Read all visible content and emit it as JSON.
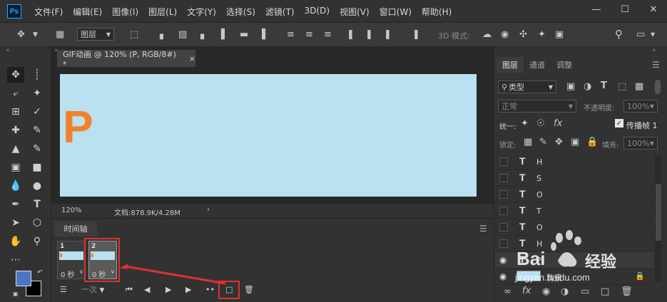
{
  "app": {
    "logo_text": "Ps"
  },
  "menu": [
    "文件(F)",
    "编辑(E)",
    "图像(I)",
    "图层(L)",
    "文字(Y)",
    "选择(S)",
    "滤镜(T)",
    "3D(D)",
    "视图(V)",
    "窗口(W)",
    "帮助(H)"
  ],
  "options": {
    "auto_select_value": "图层",
    "mode3d_label": "3D 模式:"
  },
  "document": {
    "tab_title": "GIF动画 @ 120% (P, RGB/8#) *",
    "canvas_text": "P",
    "zoom": "120%",
    "doc_info": "文档:878.9K/4.28M",
    "canvas_color": "#b9e1f0",
    "letter_color": "#f2812e"
  },
  "timeline": {
    "tab_label": "时间轴",
    "loop_option": "一次",
    "frames": [
      {
        "number": "1",
        "delay": "0 秒"
      },
      {
        "number": "2",
        "delay": "0 秒"
      }
    ],
    "highlight_color": "#e0312f"
  },
  "colors": {
    "foreground": "#4a75c1",
    "background": "#000000"
  },
  "layers_panel": {
    "tabs": [
      "图层",
      "通道",
      "调整"
    ],
    "filter_label": "类型",
    "blend_mode": "正常",
    "opacity_label": "不透明度:",
    "opacity_value": "100%",
    "unify_label": "统一:",
    "propagate_label": "传播帧 1",
    "lock_label": "锁定:",
    "fill_label": "填充:",
    "fill_value": "100%",
    "layers": [
      {
        "type": "text",
        "name": "H"
      },
      {
        "type": "text",
        "name": "S"
      },
      {
        "type": "text",
        "name": "O"
      },
      {
        "type": "text",
        "name": "T"
      },
      {
        "type": "text",
        "name": "O"
      },
      {
        "type": "text",
        "name": "H"
      },
      {
        "type": "text",
        "name": "P"
      },
      {
        "type": "image",
        "name": "背景"
      }
    ]
  },
  "watermark": {
    "brand": "Bai",
    "brand2": "经验",
    "url": "jingyan.baidu.com"
  }
}
